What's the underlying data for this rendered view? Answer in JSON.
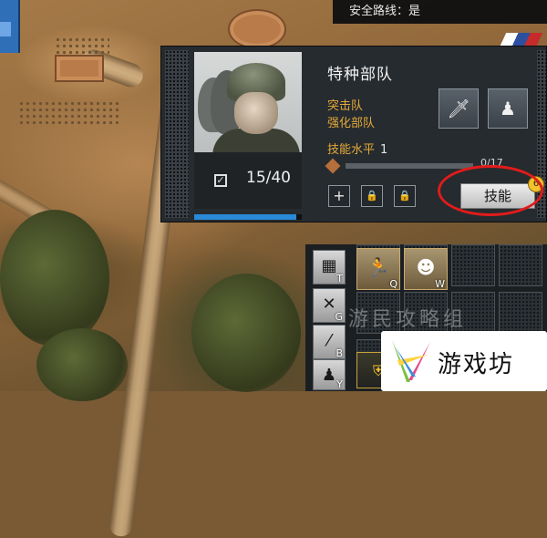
{
  "hud": {
    "safe_route_label": "安全路线：是"
  },
  "unit_panel": {
    "title": "特种部队",
    "tags": [
      "突击队",
      "强化部队"
    ],
    "skill_level_label": "技能水平",
    "skill_level_value": "1",
    "xp_text": "0/17",
    "xp_progress": 0.0,
    "squad_count": "15/40",
    "health_fraction": 0.95,
    "skill_button_label": "技能",
    "skill_points_badge": "6",
    "ability_icons": [
      "knife-icon",
      "soldier-icon"
    ],
    "upgrade_slots": [
      {
        "icon": "plus-icon",
        "glyph": "+"
      },
      {
        "icon": "lock-icon",
        "glyph": "🔒"
      },
      {
        "icon": "lock-icon",
        "glyph": "🔒"
      }
    ]
  },
  "command_grid": {
    "side_commands": [
      {
        "icon": "build-icon",
        "hotkey": "T"
      },
      {
        "icon": "crossed-guns-icon",
        "hotkey": "G"
      },
      {
        "icon": "rifle-icon",
        "hotkey": "B"
      },
      {
        "icon": "squad-icon",
        "hotkey": "Y"
      }
    ],
    "unit_cards": [
      {
        "icon": "soldier-crouch-icon",
        "hotkey": "Q"
      },
      {
        "icon": "soldier-portrait-icon",
        "hotkey": "W"
      }
    ]
  },
  "watermark": "游民攻略组",
  "logo": {
    "text": "游戏坊"
  },
  "colors": {
    "accent_orange": "#e3a93a",
    "health_blue": "#2a8ad8",
    "annotation_red": "#e11b1b",
    "badge_yellow": "#f3c22c"
  }
}
